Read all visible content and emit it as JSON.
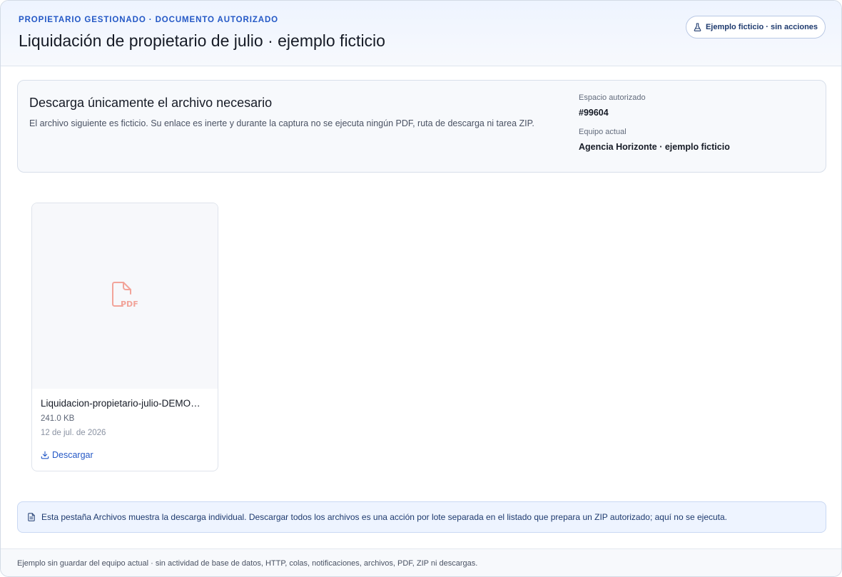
{
  "header": {
    "eyebrow": "PROPIETARIO GESTIONADO · DOCUMENTO AUTORIZADO",
    "title": "Liquidación de propietario de julio · ejemplo ficticio",
    "badge_label": "Ejemplo ficticio · sin acciones",
    "badge_icon": "flask-icon"
  },
  "info": {
    "title": "Descarga únicamente el archivo necesario",
    "description": "El archivo siguiente es ficticio. Su enlace es inerte y durante la captura no se ejecuta ningún PDF, ruta de descarga ni tarea ZIP.",
    "space_label": "Espacio autorizado",
    "space_value": "#99604",
    "team_label": "Equipo actual",
    "team_value": "Agencia Horizonte · ejemplo ficticio"
  },
  "files": [
    {
      "name": "Liquidacion-propietario-julio-DEMO…",
      "size": "241.0 KB",
      "date": "12 de jul. de 2026",
      "download_label": "Descargar",
      "preview_icon": "pdf-file-icon",
      "preview_label": "PDF"
    }
  ],
  "notice": {
    "text": "Esta pestaña Archivos muestra la descarga individual. Descargar todos los archivos es una acción por lote separada en el listado que prepara un ZIP autorizado; aquí no se ejecuta.",
    "icon": "document-icon"
  },
  "footer": {
    "text": "Ejemplo sin guardar del equipo actual · sin actividad de base de datos, HTTP, colas, notificaciones, archivos, PDF, ZIP ni descargas."
  },
  "colors": {
    "accent": "#2458c6",
    "pdf_icon": "#f2a49a",
    "notice_bg": "#eef4ff"
  }
}
